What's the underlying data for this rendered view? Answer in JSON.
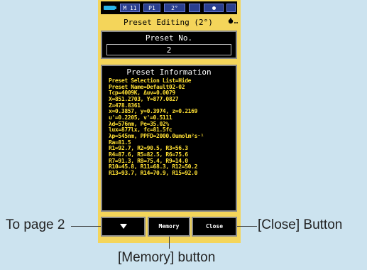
{
  "status_bar": {
    "mode": "M 11",
    "preset_slot": "P1",
    "angle": "2°"
  },
  "header": {
    "title": "Preset Editing (2°)",
    "info_icon": "info-icon"
  },
  "preset": {
    "label": "Preset No.",
    "value": "2"
  },
  "information": {
    "title": "Preset Information",
    "lines": [
      "Preset Selection List=Hide",
      "Preset Name=Default02-02",
      "Tcp=4009K, Δuv=0.0079",
      "X=851.2703, Y=877.0827",
      "Z=478.8361",
      "x=0.3857, y=0.3974, z=0.2169",
      "u'=0.2205, v'=0.5111",
      "λd=576nm, Pe=35.02%",
      "lux=877lx, fc=81.5fc",
      "λp=545nm, PPFD=2000.0umolm²s⁻¹",
      "Ra=81.5",
      "R1=92.7, R2=90.5, R3=56.3",
      "R4=87.6, R5=82.5, R6=75.6",
      "R7=91.3, R8=75.4, R9=14.0",
      "R10=45.8, R11=68.3, R12=50.2",
      "R13=93.7, R14=70.9, R15=92.0"
    ]
  },
  "buttons": {
    "page_icon": "triangle-down-icon",
    "memory": "Memory",
    "close": "Close"
  },
  "callouts": {
    "to_page_2": "To page 2",
    "close_button": "[Close] Button",
    "memory_button": "[Memory] button"
  },
  "colors": {
    "device_body": "#f4d55a",
    "screen": "#000000",
    "info_text": "#ffe033",
    "background": "#cce3ef"
  }
}
